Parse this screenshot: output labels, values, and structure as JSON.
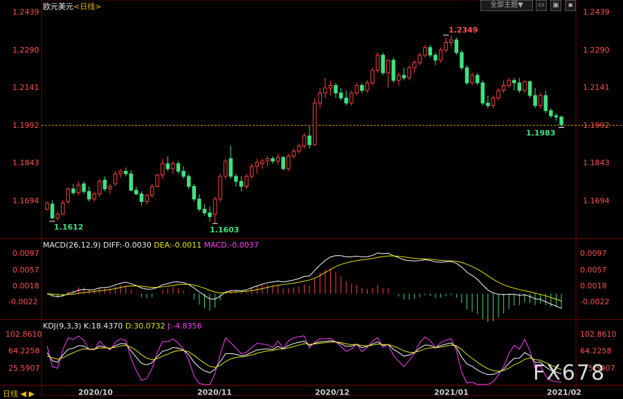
{
  "header": {
    "symbol": "欧元美元",
    "period": "<日线>",
    "theme_button": "全部主题",
    "theme_arrow": "▼"
  },
  "price_axis": [
    "1.2439",
    "1.2290",
    "1.2141",
    "1.1992",
    "1.1843",
    "1.1694"
  ],
  "price_marker_label": "1.1992",
  "annotations": {
    "high": "1.2349",
    "low_oct": "1.1612",
    "low_nov": "1.1603",
    "last_low": "1.1983"
  },
  "macd": {
    "title": "MACD(26,12,9)",
    "diff": "DIFF:-0.0030",
    "dea": "DEA:-0.0011",
    "macd": "MACD:-0.0037",
    "axis": [
      "0.0097",
      "0.0057",
      "0.0018",
      "-0.0022"
    ]
  },
  "kdj": {
    "title": "KDJ(9,3,3)",
    "k": "K:18.4370",
    "d": "D:30.0732",
    "j": "J:-4.8356",
    "axis": [
      "102.8610",
      "64.2258",
      "25.5907"
    ],
    "axis_right_partial": "5.5907"
  },
  "xaxis": {
    "left_label": "日线",
    "dates": [
      "2020/10",
      "2020/11",
      "2020/12",
      "2021/01",
      "2021/02"
    ]
  },
  "watermark": "FX678",
  "colors": {
    "up": "#ff4040",
    "down": "#40e080",
    "diff": "#ffffff",
    "dea": "#e8e800",
    "j": "#ff40ff",
    "axis": "#ff5050"
  },
  "chart_data": {
    "type": "candlestick",
    "candles": [
      [
        1.166,
        1.169,
        1.1655,
        1.1685
      ],
      [
        1.168,
        1.1695,
        1.162,
        1.1625
      ],
      [
        1.1625,
        1.165,
        1.1612,
        1.164
      ],
      [
        1.164,
        1.1695,
        1.1635,
        1.1685
      ],
      [
        1.169,
        1.1745,
        1.168,
        1.174
      ],
      [
        1.174,
        1.176,
        1.1715,
        1.1725
      ],
      [
        1.1725,
        1.177,
        1.1715,
        1.1755
      ],
      [
        1.176,
        1.177,
        1.172,
        1.173
      ],
      [
        1.173,
        1.175,
        1.169,
        1.17
      ],
      [
        1.17,
        1.173,
        1.169,
        1.172
      ],
      [
        1.172,
        1.178,
        1.171,
        1.177
      ],
      [
        1.1775,
        1.179,
        1.173,
        1.174
      ],
      [
        1.174,
        1.176,
        1.172,
        1.175
      ],
      [
        1.176,
        1.181,
        1.175,
        1.18
      ],
      [
        1.18,
        1.182,
        1.1785,
        1.181
      ],
      [
        1.181,
        1.1825,
        1.179,
        1.18
      ],
      [
        1.18,
        1.1815,
        1.173,
        1.1735
      ],
      [
        1.1735,
        1.175,
        1.1715,
        1.172
      ],
      [
        1.172,
        1.173,
        1.1675,
        1.169
      ],
      [
        1.169,
        1.172,
        1.168,
        1.1715
      ],
      [
        1.1715,
        1.176,
        1.1705,
        1.175
      ],
      [
        1.175,
        1.18,
        1.1745,
        1.1795
      ],
      [
        1.1795,
        1.186,
        1.178,
        1.184
      ],
      [
        1.184,
        1.187,
        1.181,
        1.182
      ],
      [
        1.182,
        1.185,
        1.18,
        1.184
      ],
      [
        1.184,
        1.185,
        1.18,
        1.181
      ],
      [
        1.181,
        1.183,
        1.178,
        1.179
      ],
      [
        1.179,
        1.18,
        1.174,
        1.175
      ],
      [
        1.175,
        1.176,
        1.169,
        1.17
      ],
      [
        1.17,
        1.172,
        1.165,
        1.166
      ],
      [
        1.166,
        1.168,
        1.1635,
        1.1645
      ],
      [
        1.1645,
        1.167,
        1.161,
        1.163
      ],
      [
        1.164,
        1.171,
        1.1603,
        1.17
      ],
      [
        1.17,
        1.18,
        1.169,
        1.179
      ],
      [
        1.179,
        1.186,
        1.178,
        1.185
      ],
      [
        1.186,
        1.191,
        1.178,
        1.179
      ],
      [
        1.179,
        1.18,
        1.175,
        1.177
      ],
      [
        1.177,
        1.179,
        1.173,
        1.175
      ],
      [
        1.175,
        1.18,
        1.174,
        1.179
      ],
      [
        1.179,
        1.184,
        1.178,
        1.183
      ],
      [
        1.183,
        1.186,
        1.18,
        1.1845
      ],
      [
        1.184,
        1.186,
        1.182,
        1.185
      ],
      [
        1.185,
        1.187,
        1.183,
        1.186
      ],
      [
        1.186,
        1.187,
        1.184,
        1.185
      ],
      [
        1.185,
        1.188,
        1.1835,
        1.1865
      ],
      [
        1.1865,
        1.187,
        1.1815,
        1.182
      ],
      [
        1.182,
        1.188,
        1.181,
        1.187
      ],
      [
        1.187,
        1.19,
        1.186,
        1.189
      ],
      [
        1.189,
        1.192,
        1.188,
        1.191
      ],
      [
        1.191,
        1.196,
        1.19,
        1.195
      ],
      [
        1.195,
        1.199,
        1.19,
        1.1915
      ],
      [
        1.1915,
        1.21,
        1.191,
        1.208
      ],
      [
        1.208,
        1.214,
        1.206,
        1.212
      ],
      [
        1.212,
        1.218,
        1.21,
        1.214
      ],
      [
        1.214,
        1.217,
        1.211,
        1.215
      ],
      [
        1.215,
        1.216,
        1.21,
        1.212
      ],
      [
        1.212,
        1.214,
        1.209,
        1.21
      ],
      [
        1.21,
        1.213,
        1.207,
        1.208
      ],
      [
        1.208,
        1.213,
        1.207,
        1.212
      ],
      [
        1.212,
        1.216,
        1.211,
        1.215
      ],
      [
        1.215,
        1.216,
        1.212,
        1.213
      ],
      [
        1.213,
        1.217,
        1.212,
        1.216
      ],
      [
        1.216,
        1.222,
        1.215,
        1.221
      ],
      [
        1.221,
        1.228,
        1.22,
        1.227
      ],
      [
        1.227,
        1.228,
        1.219,
        1.22
      ],
      [
        1.22,
        1.223,
        1.214,
        1.225
      ],
      [
        1.225,
        1.226,
        1.216,
        1.217
      ],
      [
        1.217,
        1.22,
        1.215,
        1.219
      ],
      [
        1.219,
        1.222,
        1.217,
        1.218
      ],
      [
        1.218,
        1.223,
        1.217,
        1.222
      ],
      [
        1.222,
        1.225,
        1.22,
        1.224
      ],
      [
        1.224,
        1.228,
        1.223,
        1.227
      ],
      [
        1.227,
        1.231,
        1.226,
        1.23
      ],
      [
        1.23,
        1.231,
        1.226,
        1.227
      ],
      [
        1.227,
        1.228,
        1.223,
        1.225
      ],
      [
        1.225,
        1.23,
        1.224,
        1.229
      ],
      [
        1.229,
        1.234,
        1.228,
        1.232
      ],
      [
        1.232,
        1.2349,
        1.23,
        1.233
      ],
      [
        1.233,
        1.234,
        1.227,
        1.228
      ],
      [
        1.228,
        1.229,
        1.221,
        1.222
      ],
      [
        1.222,
        1.223,
        1.215,
        1.216
      ],
      [
        1.216,
        1.22,
        1.215,
        1.219
      ],
      [
        1.219,
        1.22,
        1.215,
        1.216
      ],
      [
        1.216,
        1.217,
        1.207,
        1.208
      ],
      [
        1.208,
        1.211,
        1.206,
        1.207
      ],
      [
        1.207,
        1.211,
        1.206,
        1.21
      ],
      [
        1.21,
        1.214,
        1.209,
        1.213
      ],
      [
        1.213,
        1.217,
        1.212,
        1.215
      ],
      [
        1.215,
        1.218,
        1.214,
        1.217
      ],
      [
        1.217,
        1.218,
        1.213,
        1.216
      ],
      [
        1.216,
        1.218,
        1.212,
        1.213
      ],
      [
        1.213,
        1.217,
        1.212,
        1.2165
      ],
      [
        1.2165,
        1.217,
        1.21,
        1.211
      ],
      [
        1.211,
        1.214,
        1.206,
        1.207
      ],
      [
        1.207,
        1.212,
        1.206,
        1.211
      ],
      [
        1.211,
        1.213,
        1.204,
        1.205
      ],
      [
        1.205,
        1.206,
        1.202,
        1.203
      ],
      [
        1.203,
        1.204,
        1.201,
        1.2025
      ],
      [
        1.2025,
        1.203,
        1.1983,
        1.1995
      ]
    ],
    "ylim": [
      1.158,
      1.246
    ]
  }
}
